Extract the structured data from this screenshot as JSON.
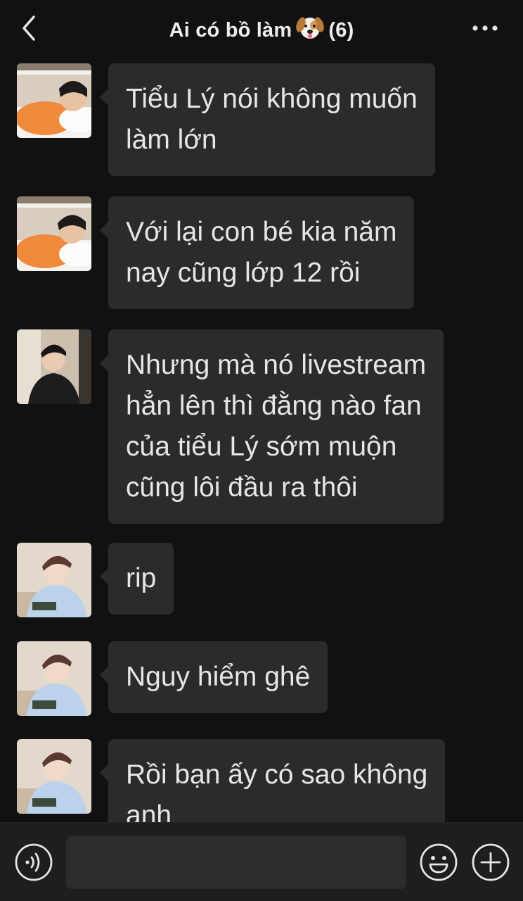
{
  "header": {
    "title_prefix": "Ai có bồ làm",
    "emoji": "dog-face-emoji",
    "member_count": "(6)",
    "back_icon": "chevron-left-icon",
    "more_icon": "more-dots-icon"
  },
  "messages": [
    {
      "text": "Tiểu Lý nói không muốn\nlàm lớn",
      "avatar": "avatar-orange-shirt"
    },
    {
      "text": "Với lại con bé kia năm\nnay cũng lớp 12 rồi",
      "avatar": "avatar-orange-shirt"
    },
    {
      "text": "Nhưng mà nó livestream\nhẳn lên thì đằng nào fan\ncủa tiểu Lý sớm muộn\ncũng lôi đầu ra thôi",
      "avatar": "avatar-dark-suit"
    },
    {
      "text": "rip",
      "avatar": "avatar-blue-shirt"
    },
    {
      "text": "Nguy hiểm ghê",
      "avatar": "avatar-blue-shirt"
    },
    {
      "text": "Rồi bạn ấy có sao không\nanh",
      "avatar": "avatar-blue-shirt"
    }
  ],
  "input_bar": {
    "placeholder": "",
    "voice_icon": "voice-icon",
    "emoji_icon": "smiley-icon",
    "plus_icon": "plus-icon"
  },
  "colors": {
    "background": "#111111",
    "bubble": "#2b2b2b",
    "text": "#e6e6e6",
    "input_bar": "#1e1e1e"
  }
}
